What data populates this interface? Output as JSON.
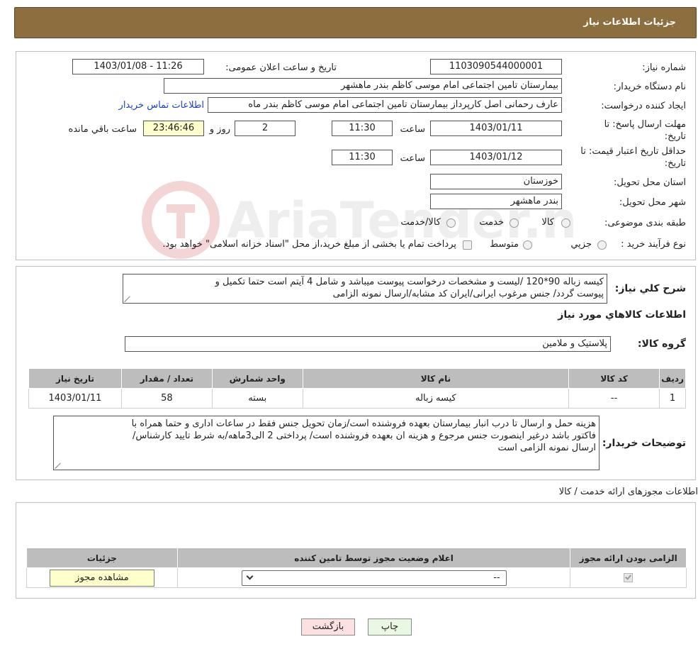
{
  "header": {
    "title": "جزئیات اطلاعات نیاز"
  },
  "need_info": {
    "need_number_label": "شماره نیاز:",
    "need_number": "1103090544000001",
    "announce_label": "تاریخ و ساعت اعلان عمومی:",
    "announce_value": "1403/01/08 - 11:26",
    "buyer_org_label": "نام دستگاه خریدار:",
    "buyer_org": "بیمارستان تامین اجتماعی امام موسی کاظم بندر ماهشهر",
    "requester_label": "ایجاد کننده درخواست:",
    "requester": "عارف رحمانی اصل کارپرداز بیمارستان تامین اجتماعی امام موسی کاظم بندر ماه",
    "contact_link": "اطلاعات تماس خریدار",
    "deadline_label": "مهلت ارسال پاسخ: تا تاریخ:",
    "deadline_date": "1403/01/11",
    "time_label": "ساعت",
    "deadline_time": "11:30",
    "days_value": "2",
    "days_label": "روز و",
    "remaining_value": "23:46:46",
    "remaining_label": "ساعت باقي مانده",
    "validity_label": "حداقل تاریخ اعتبار قیمت: تا تاریخ:",
    "validity_date": "1403/01/12",
    "validity_time": "11:30",
    "province_label": "استان محل تحویل:",
    "province": "خوزستان",
    "city_label": "شهر محل تحویل:",
    "city": "بندر ماهشهر",
    "category_label": "طبقه بندی موضوعی:",
    "category_options": [
      "کالا",
      "خدمت",
      "کالا/خدمت"
    ],
    "process_label": "نوع فرآیند خرید :",
    "process_options": [
      "جزیي",
      "متوسط"
    ],
    "process_note": "پرداخت تمام یا بخشی از مبلغ خرید،از محل \"اسناد خزانه اسلامی\" خواهد بود."
  },
  "description": {
    "summary_label": "شرح کلي نیاز:",
    "summary_line1": "کیسه زباله 90*120 /لیست و مشخصات درخواست پیوست میباشد و شامل 4 آیتم است حتما تکمیل و",
    "summary_line2": "پیوست گردد/ جنس مرغوب ایرانی/ایران کد مشابه/ارسال نمونه الزامی",
    "goods_info_title": "اطلاعات کالاهاي مورد نیاز",
    "goods_group_label": "گروه کالا:",
    "goods_group": "پلاستیک و ملامین",
    "table_headers": [
      "رديف",
      "کد کالا",
      "نام کالا",
      "واحد شمارش",
      "تعداد / مقدار",
      "تاریخ نیاز"
    ],
    "table_rows": [
      [
        "1",
        "--",
        "کیسه زباله",
        "بسته",
        "58",
        "1403/01/11"
      ]
    ],
    "buyer_notes_label": "توضیحات خریدار:",
    "buyer_notes_line1": "هزینه حمل و ارسال تا درب انبار بیمارستان بعهده فروشنده است/زمان تحویل جنس فقط در ساعات اداری و حتما همراه با",
    "buyer_notes_line2": "فاکتور باشد درغیر اینصورت جنس مرجوع و هزینه ان بعهده فروشنده است/ پرداختی 2 الی3ماهه/به شرط تایید کارشناس/",
    "buyer_notes_line3": "ارسال نمونه الزامی است"
  },
  "permits": {
    "section_title": "اطلاعات مجوزهای ارائه خدمت / کالا",
    "table_headers": [
      "الزامی بودن ارائه مجوز",
      "اعلام وضعیت مجوز توسط تامین کننده",
      "جزئیات"
    ],
    "select_value": "--",
    "view_button": "مشاهده مجوز"
  },
  "actions": {
    "print_button": "چاپ",
    "back_button": "بازگشت"
  },
  "watermark": {
    "text": "AriaTender.neT"
  },
  "colors": {
    "header_bg": "#8d6e3f",
    "remaining_bg": "#ffffcc",
    "back_button_bg": "#fde0e0",
    "print_button_bg": "#e9f8e2",
    "link": "#1a3fcf"
  }
}
